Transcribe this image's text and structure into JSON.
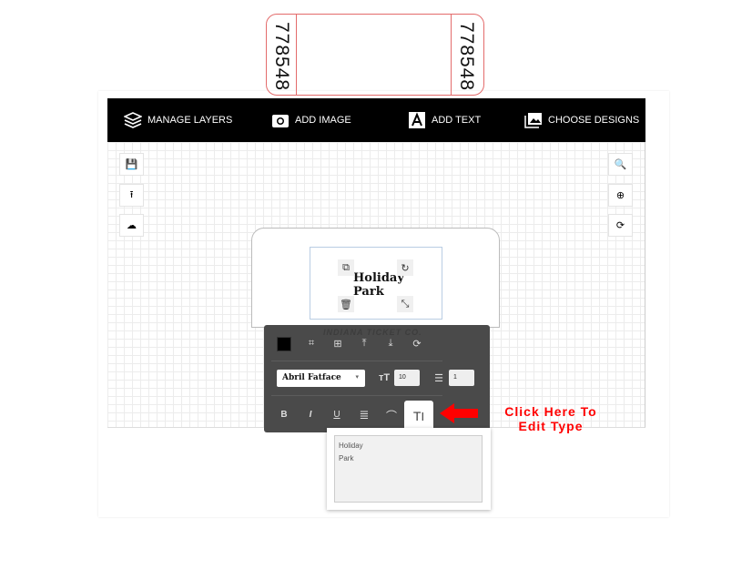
{
  "header": {
    "items": [
      {
        "label": "MANAGE LAYERS",
        "icon": "layers-icon"
      },
      {
        "label": "ADD IMAGE",
        "icon": "camera-icon"
      },
      {
        "label": "ADD TEXT",
        "icon": "text-icon"
      },
      {
        "label": "CHOOSE DESIGNS",
        "icon": "images-icon"
      }
    ]
  },
  "left_tools": [
    "save-icon",
    "upload-icon",
    "cloud-download-icon"
  ],
  "right_tools": [
    "zoom-out-icon",
    "zoom-in-icon",
    "reset-icon"
  ],
  "ticket": {
    "number": "778548",
    "text_line1": "Holiday",
    "text_line2": "Park",
    "brand": "INDIANA TICKET CO.",
    "stub_color": "#e36b6b"
  },
  "text_panel": {
    "color": "#000000",
    "font": "Abril Fatface",
    "font_size": "10",
    "line_height": "1",
    "bold": "B",
    "italic": "I",
    "underline": "U",
    "edit_tab": "T",
    "textarea_value": "Holiday\nPark"
  },
  "callout": {
    "line1": "Click Here To",
    "line2": "Edit Type",
    "color": "#ff0000"
  }
}
